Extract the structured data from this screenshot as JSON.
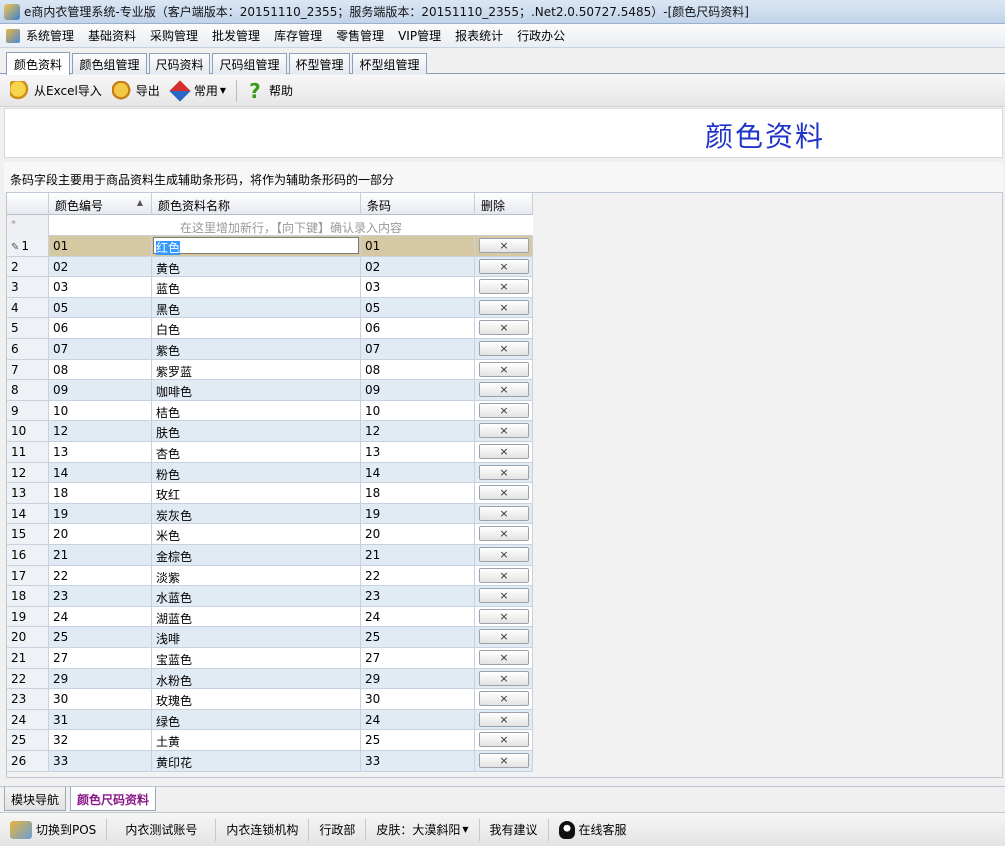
{
  "window": {
    "title": "e商内衣管理系统-专业版（客户端版本：20151110_2355；服务端版本：20151110_2355；.Net2.0.50727.5485）-[颜色尺码资料]"
  },
  "menu": {
    "items": [
      "系统管理",
      "基础资料",
      "采购管理",
      "批发管理",
      "库存管理",
      "零售管理",
      "VIP管理",
      "报表统计",
      "行政办公"
    ]
  },
  "tabs": [
    "颜色资料",
    "颜色组管理",
    "尺码资料",
    "尺码组管理",
    "杯型管理",
    "杯型组管理"
  ],
  "toolbar": {
    "import_label": "从Excel导入",
    "export_label": "导出",
    "common_label": "常用",
    "help_label": "帮助"
  },
  "page": {
    "heading": "颜色资料",
    "hint": "条码字段主要用于商品资料生成辅助条形码，将作为辅助条形码的一部分"
  },
  "grid": {
    "columns": [
      "颜色编号",
      "颜色资料名称",
      "条码",
      "删除"
    ],
    "new_row_placeholder": "在这里增加新行，【向下键】确认录入内容",
    "new_row_marker": "*",
    "delete_symbol": "×",
    "selected_row_index": 0,
    "rows": [
      {
        "num": "1",
        "code": "01",
        "name": "红色",
        "barcode": "01"
      },
      {
        "num": "2",
        "code": "02",
        "name": "黄色",
        "barcode": "02"
      },
      {
        "num": "3",
        "code": "03",
        "name": "蓝色",
        "barcode": "03"
      },
      {
        "num": "4",
        "code": "05",
        "name": "黑色",
        "barcode": "05"
      },
      {
        "num": "5",
        "code": "06",
        "name": "白色",
        "barcode": "06"
      },
      {
        "num": "6",
        "code": "07",
        "name": "紫色",
        "barcode": "07"
      },
      {
        "num": "7",
        "code": "08",
        "name": "紫罗蓝",
        "barcode": "08"
      },
      {
        "num": "8",
        "code": "09",
        "name": "咖啡色",
        "barcode": "09"
      },
      {
        "num": "9",
        "code": "10",
        "name": "桔色",
        "barcode": "10"
      },
      {
        "num": "10",
        "code": "12",
        "name": "肤色",
        "barcode": "12"
      },
      {
        "num": "11",
        "code": "13",
        "name": "杏色",
        "barcode": "13"
      },
      {
        "num": "12",
        "code": "14",
        "name": "粉色",
        "barcode": "14"
      },
      {
        "num": "13",
        "code": "18",
        "name": "玫红",
        "barcode": "18"
      },
      {
        "num": "14",
        "code": "19",
        "name": "炭灰色",
        "barcode": "19"
      },
      {
        "num": "15",
        "code": "20",
        "name": "米色",
        "barcode": "20"
      },
      {
        "num": "16",
        "code": "21",
        "name": "金棕色",
        "barcode": "21"
      },
      {
        "num": "17",
        "code": "22",
        "name": "淡紫",
        "barcode": "22"
      },
      {
        "num": "18",
        "code": "23",
        "name": "水蓝色",
        "barcode": "23"
      },
      {
        "num": "19",
        "code": "24",
        "name": "湖蓝色",
        "barcode": "24"
      },
      {
        "num": "20",
        "code": "25",
        "name": "浅啡",
        "barcode": "25"
      },
      {
        "num": "21",
        "code": "27",
        "name": "宝蓝色",
        "barcode": "27"
      },
      {
        "num": "22",
        "code": "29",
        "name": "水粉色",
        "barcode": "29"
      },
      {
        "num": "23",
        "code": "30",
        "name": "玫瑰色",
        "barcode": "30"
      },
      {
        "num": "24",
        "code": "31",
        "name": "绿色",
        "barcode": "24"
      },
      {
        "num": "25",
        "code": "32",
        "name": "土黄",
        "barcode": "25"
      },
      {
        "num": "26",
        "code": "33",
        "name": "黄印花",
        "barcode": "33"
      }
    ]
  },
  "bottom_tabs": [
    "模块导航",
    "颜色尺码资料"
  ],
  "statusbar": {
    "pos_label": "切换到POS",
    "account": "内衣测试账号",
    "org": "内衣连锁机构",
    "dept": "行政部",
    "skin": "皮肤：大漠斜阳",
    "feedback": "我有建议",
    "support": "在线客服"
  },
  "colors": {
    "heading": "#1f34c9",
    "selected_row": "#d6c8a2",
    "alt_row": "#e1ebf4",
    "active_bottom_tab": "#8a1a8a"
  }
}
